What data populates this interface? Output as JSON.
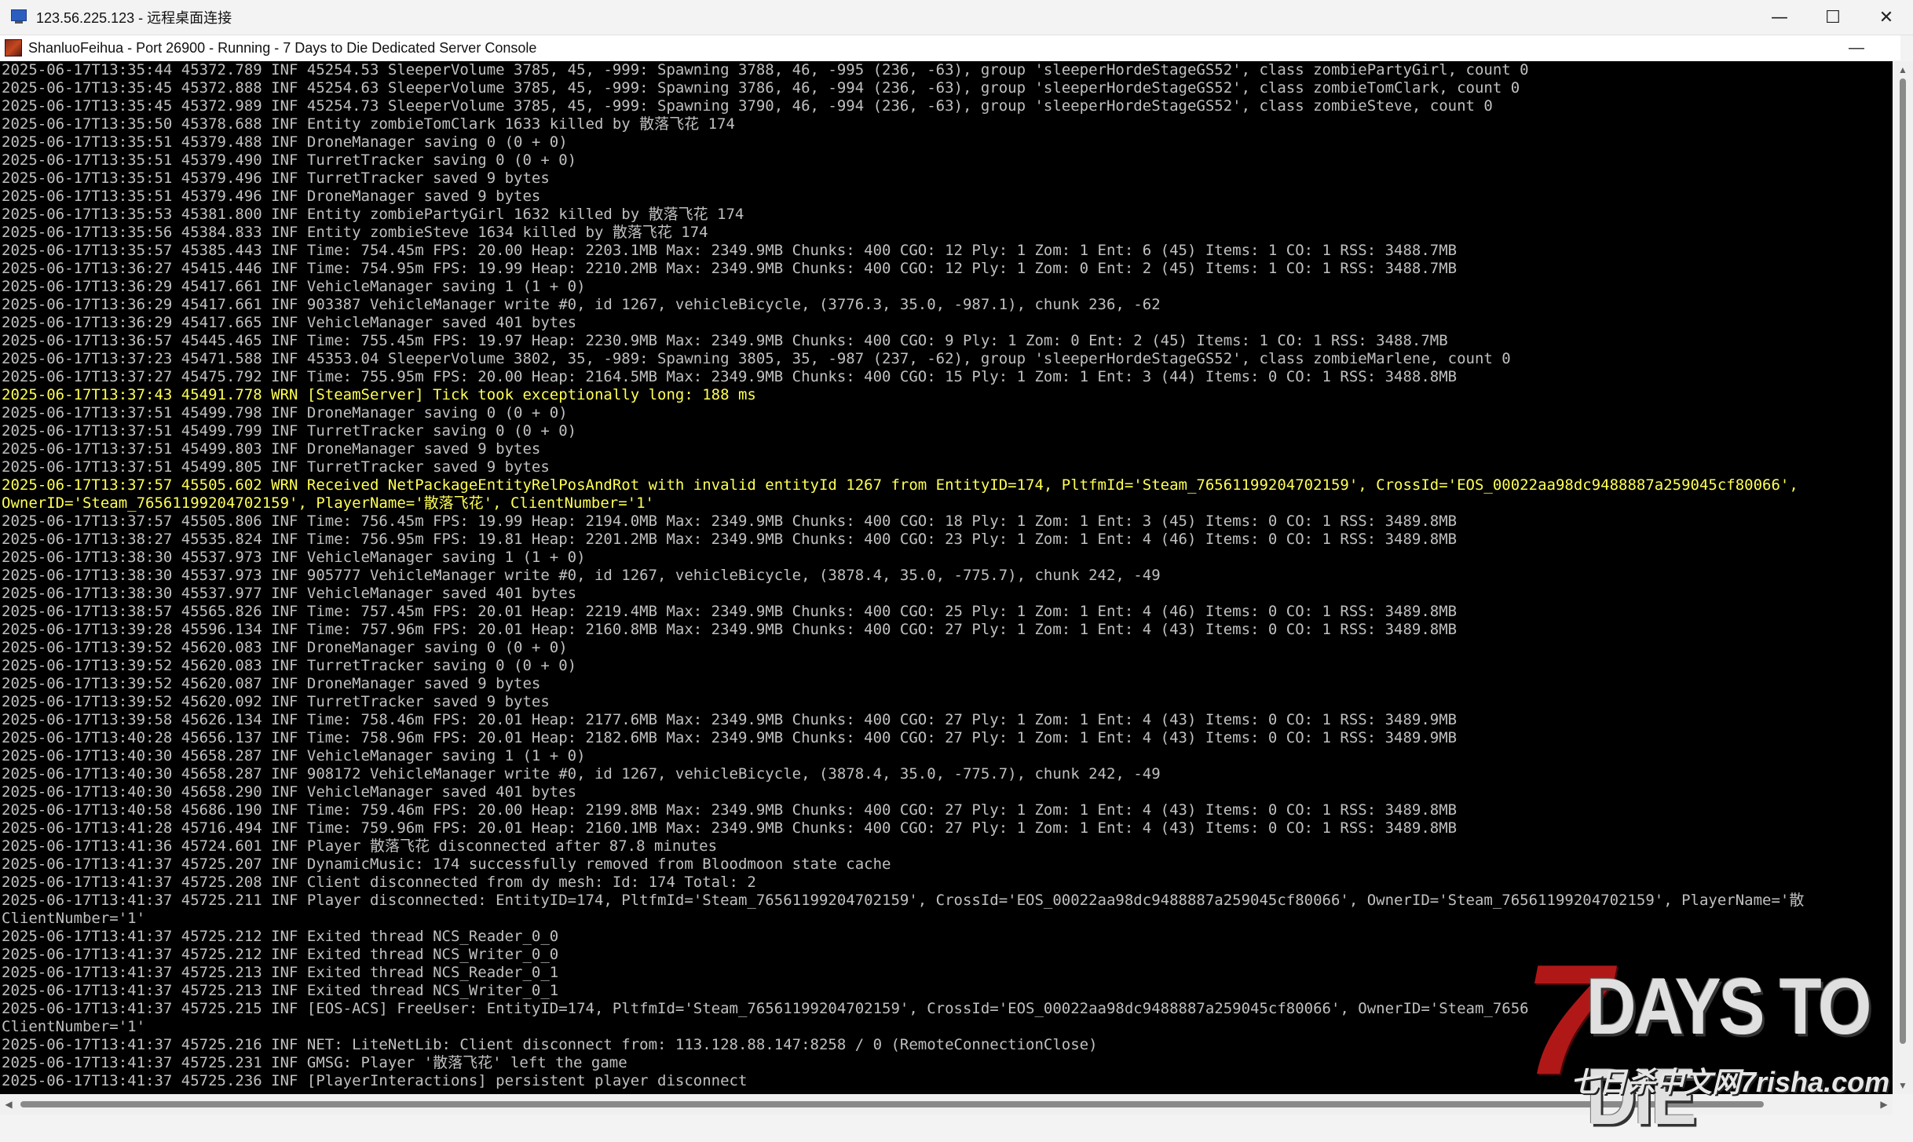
{
  "rdp_window": {
    "title": "123.56.225.123 - 远程桌面连接",
    "minimize_glyph": "—",
    "maximize_glyph": "☐",
    "close_glyph": "✕"
  },
  "console_window": {
    "title": "ShanluoFeihua - Port 26900 - Running - 7 Days to Die Dedicated Server Console",
    "minimize_glyph": "—"
  },
  "colors": {
    "inf_text": "#c0c0c0",
    "wrn_text": "#ffff55",
    "console_bg": "#000000"
  },
  "log_lines": [
    {
      "level": "inf",
      "text": "2025-06-17T13:35:44 45372.789 INF 45254.53 SleeperVolume 3785, 45, -999: Spawning 3788, 46, -995 (236, -63), group 'sleeperHordeStageGS52', class zombiePartyGirl, count 0"
    },
    {
      "level": "inf",
      "text": "2025-06-17T13:35:45 45372.888 INF 45254.63 SleeperVolume 3785, 45, -999: Spawning 3786, 46, -994 (236, -63), group 'sleeperHordeStageGS52', class zombieTomClark, count 0"
    },
    {
      "level": "inf",
      "text": "2025-06-17T13:35:45 45372.989 INF 45254.73 SleeperVolume 3785, 45, -999: Spawning 3790, 46, -994 (236, -63), group 'sleeperHordeStageGS52', class zombieSteve, count 0"
    },
    {
      "level": "inf",
      "text": "2025-06-17T13:35:50 45378.688 INF Entity zombieTomClark 1633 killed by 散落飞花 174"
    },
    {
      "level": "inf",
      "text": "2025-06-17T13:35:51 45379.488 INF DroneManager saving 0 (0 + 0)"
    },
    {
      "level": "inf",
      "text": "2025-06-17T13:35:51 45379.490 INF TurretTracker saving 0 (0 + 0)"
    },
    {
      "level": "inf",
      "text": "2025-06-17T13:35:51 45379.496 INF TurretTracker saved 9 bytes"
    },
    {
      "level": "inf",
      "text": "2025-06-17T13:35:51 45379.496 INF DroneManager saved 9 bytes"
    },
    {
      "level": "inf",
      "text": "2025-06-17T13:35:53 45381.800 INF Entity zombiePartyGirl 1632 killed by 散落飞花 174"
    },
    {
      "level": "inf",
      "text": "2025-06-17T13:35:56 45384.833 INF Entity zombieSteve 1634 killed by 散落飞花 174"
    },
    {
      "level": "inf",
      "text": "2025-06-17T13:35:57 45385.443 INF Time: 754.45m FPS: 20.00 Heap: 2203.1MB Max: 2349.9MB Chunks: 400 CGO: 12 Ply: 1 Zom: 1 Ent: 6 (45) Items: 1 CO: 1 RSS: 3488.7MB"
    },
    {
      "level": "inf",
      "text": "2025-06-17T13:36:27 45415.446 INF Time: 754.95m FPS: 19.99 Heap: 2210.2MB Max: 2349.9MB Chunks: 400 CGO: 12 Ply: 1 Zom: 0 Ent: 2 (45) Items: 1 CO: 1 RSS: 3488.7MB"
    },
    {
      "level": "inf",
      "text": "2025-06-17T13:36:29 45417.661 INF VehicleManager saving 1 (1 + 0)"
    },
    {
      "level": "inf",
      "text": "2025-06-17T13:36:29 45417.661 INF 903387 VehicleManager write #0, id 1267, vehicleBicycle, (3776.3, 35.0, -987.1), chunk 236, -62"
    },
    {
      "level": "inf",
      "text": "2025-06-17T13:36:29 45417.665 INF VehicleManager saved 401 bytes"
    },
    {
      "level": "inf",
      "text": "2025-06-17T13:36:57 45445.465 INF Time: 755.45m FPS: 19.97 Heap: 2230.9MB Max: 2349.9MB Chunks: 400 CGO: 9 Ply: 1 Zom: 0 Ent: 2 (45) Items: 1 CO: 1 RSS: 3488.7MB"
    },
    {
      "level": "inf",
      "text": "2025-06-17T13:37:23 45471.588 INF 45353.04 SleeperVolume 3802, 35, -989: Spawning 3805, 35, -987 (237, -62), group 'sleeperHordeStageGS52', class zombieMarlene, count 0"
    },
    {
      "level": "inf",
      "text": "2025-06-17T13:37:27 45475.792 INF Time: 755.95m FPS: 20.00 Heap: 2164.5MB Max: 2349.9MB Chunks: 400 CGO: 15 Ply: 1 Zom: 1 Ent: 3 (44) Items: 0 CO: 1 RSS: 3488.8MB"
    },
    {
      "level": "wrn",
      "text": "2025-06-17T13:37:43 45491.778 WRN [SteamServer] Tick took exceptionally long: 188 ms"
    },
    {
      "level": "inf",
      "text": "2025-06-17T13:37:51 45499.798 INF DroneManager saving 0 (0 + 0)"
    },
    {
      "level": "inf",
      "text": "2025-06-17T13:37:51 45499.799 INF TurretTracker saving 0 (0 + 0)"
    },
    {
      "level": "inf",
      "text": "2025-06-17T13:37:51 45499.803 INF DroneManager saved 9 bytes"
    },
    {
      "level": "inf",
      "text": "2025-06-17T13:37:51 45499.805 INF TurretTracker saved 9 bytes"
    },
    {
      "level": "wrn",
      "text": "2025-06-17T13:37:57 45505.602 WRN Received NetPackageEntityRelPosAndRot with invalid entityId 1267 from EntityID=174, PltfmId='Steam_76561199204702159', CrossId='EOS_00022aa98dc9488887a259045cf80066',"
    },
    {
      "level": "wrn",
      "text": "OwnerID='Steam_76561199204702159', PlayerName='散落飞花', ClientNumber='1'"
    },
    {
      "level": "inf",
      "text": "2025-06-17T13:37:57 45505.806 INF Time: 756.45m FPS: 19.99 Heap: 2194.0MB Max: 2349.9MB Chunks: 400 CGO: 18 Ply: 1 Zom: 1 Ent: 3 (45) Items: 0 CO: 1 RSS: 3489.8MB"
    },
    {
      "level": "inf",
      "text": "2025-06-17T13:38:27 45535.824 INF Time: 756.95m FPS: 19.81 Heap: 2201.2MB Max: 2349.9MB Chunks: 400 CGO: 23 Ply: 1 Zom: 1 Ent: 4 (46) Items: 0 CO: 1 RSS: 3489.8MB"
    },
    {
      "level": "inf",
      "text": "2025-06-17T13:38:30 45537.973 INF VehicleManager saving 1 (1 + 0)"
    },
    {
      "level": "inf",
      "text": "2025-06-17T13:38:30 45537.973 INF 905777 VehicleManager write #0, id 1267, vehicleBicycle, (3878.4, 35.0, -775.7), chunk 242, -49"
    },
    {
      "level": "inf",
      "text": "2025-06-17T13:38:30 45537.977 INF VehicleManager saved 401 bytes"
    },
    {
      "level": "inf",
      "text": "2025-06-17T13:38:57 45565.826 INF Time: 757.45m FPS: 20.01 Heap: 2219.4MB Max: 2349.9MB Chunks: 400 CGO: 25 Ply: 1 Zom: 1 Ent: 4 (46) Items: 0 CO: 1 RSS: 3489.8MB"
    },
    {
      "level": "inf",
      "text": "2025-06-17T13:39:28 45596.134 INF Time: 757.96m FPS: 20.01 Heap: 2160.8MB Max: 2349.9MB Chunks: 400 CGO: 27 Ply: 1 Zom: 1 Ent: 4 (43) Items: 0 CO: 1 RSS: 3489.8MB"
    },
    {
      "level": "inf",
      "text": "2025-06-17T13:39:52 45620.083 INF DroneManager saving 0 (0 + 0)"
    },
    {
      "level": "inf",
      "text": "2025-06-17T13:39:52 45620.083 INF TurretTracker saving 0 (0 + 0)"
    },
    {
      "level": "inf",
      "text": "2025-06-17T13:39:52 45620.087 INF DroneManager saved 9 bytes"
    },
    {
      "level": "inf",
      "text": "2025-06-17T13:39:52 45620.092 INF TurretTracker saved 9 bytes"
    },
    {
      "level": "inf",
      "text": "2025-06-17T13:39:58 45626.134 INF Time: 758.46m FPS: 20.01 Heap: 2177.6MB Max: 2349.9MB Chunks: 400 CGO: 27 Ply: 1 Zom: 1 Ent: 4 (43) Items: 0 CO: 1 RSS: 3489.9MB"
    },
    {
      "level": "inf",
      "text": "2025-06-17T13:40:28 45656.137 INF Time: 758.96m FPS: 20.01 Heap: 2182.6MB Max: 2349.9MB Chunks: 400 CGO: 27 Ply: 1 Zom: 1 Ent: 4 (43) Items: 0 CO: 1 RSS: 3489.9MB"
    },
    {
      "level": "inf",
      "text": "2025-06-17T13:40:30 45658.287 INF VehicleManager saving 1 (1 + 0)"
    },
    {
      "level": "inf",
      "text": "2025-06-17T13:40:30 45658.287 INF 908172 VehicleManager write #0, id 1267, vehicleBicycle, (3878.4, 35.0, -775.7), chunk 242, -49"
    },
    {
      "level": "inf",
      "text": "2025-06-17T13:40:30 45658.290 INF VehicleManager saved 401 bytes"
    },
    {
      "level": "inf",
      "text": "2025-06-17T13:40:58 45686.190 INF Time: 759.46m FPS: 20.00 Heap: 2199.8MB Max: 2349.9MB Chunks: 400 CGO: 27 Ply: 1 Zom: 1 Ent: 4 (43) Items: 0 CO: 1 RSS: 3489.8MB"
    },
    {
      "level": "inf",
      "text": "2025-06-17T13:41:28 45716.494 INF Time: 759.96m FPS: 20.01 Heap: 2160.1MB Max: 2349.9MB Chunks: 400 CGO: 27 Ply: 1 Zom: 1 Ent: 4 (43) Items: 0 CO: 1 RSS: 3489.8MB"
    },
    {
      "level": "inf",
      "text": "2025-06-17T13:41:36 45724.601 INF Player 散落飞花 disconnected after 87.8 minutes"
    },
    {
      "level": "inf",
      "text": "2025-06-17T13:41:37 45725.207 INF DynamicMusic: 174 successfully removed from Bloodmoon state cache"
    },
    {
      "level": "inf",
      "text": "2025-06-17T13:41:37 45725.208 INF Client disconnected from dy mesh: Id: 174 Total: 2"
    },
    {
      "level": "inf",
      "text": "2025-06-17T13:41:37 45725.211 INF Player disconnected: EntityID=174, PltfmId='Steam_76561199204702159', CrossId='EOS_00022aa98dc9488887a259045cf80066', OwnerID='Steam_76561199204702159', PlayerName='散"
    },
    {
      "level": "inf",
      "text": "ClientNumber='1'"
    },
    {
      "level": "inf",
      "text": "2025-06-17T13:41:37 45725.212 INF Exited thread NCS_Reader_0_0"
    },
    {
      "level": "inf",
      "text": "2025-06-17T13:41:37 45725.212 INF Exited thread NCS_Writer_0_0"
    },
    {
      "level": "inf",
      "text": "2025-06-17T13:41:37 45725.213 INF Exited thread NCS_Reader_0_1"
    },
    {
      "level": "inf",
      "text": "2025-06-17T13:41:37 45725.213 INF Exited thread NCS_Writer_0_1"
    },
    {
      "level": "inf",
      "text": "2025-06-17T13:41:37 45725.215 INF [EOS-ACS] FreeUser: EntityID=174, PltfmId='Steam_76561199204702159', CrossId='EOS_00022aa98dc9488887a259045cf80066', OwnerID='Steam_7656"
    },
    {
      "level": "inf",
      "text": "ClientNumber='1'"
    },
    {
      "level": "inf",
      "text": "2025-06-17T13:41:37 45725.216 INF NET: LiteNetLib: Client disconnect from: 113.128.88.147:8258 / 0 (RemoteConnectionClose)"
    },
    {
      "level": "inf",
      "text": "2025-06-17T13:41:37 45725.231 INF GMSG: Player '散落飞花' left the game"
    },
    {
      "level": "inf",
      "text": "2025-06-17T13:41:37 45725.236 INF [PlayerInteractions] persistent player disconnect"
    }
  ],
  "watermark": {
    "seven": "7",
    "days_to_die": "DAYS TO DIE",
    "site": "七日杀中文网7risha.com"
  }
}
